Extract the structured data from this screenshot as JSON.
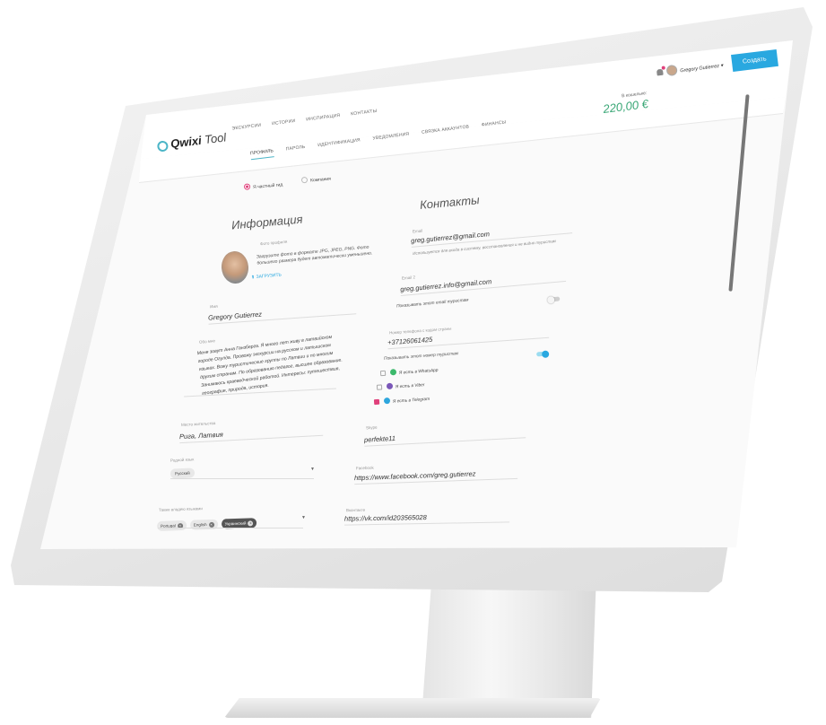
{
  "header": {
    "logo_text": "Qwixi",
    "logo_suffix": "Tool",
    "nav": [
      "ЭКСКУРСИИ",
      "ИСТОРИИ",
      "ИНСПИРАЦИЯ",
      "КОНТАКТЫ"
    ],
    "user_name": "Gregory Gutierrez",
    "create_label": "Создать",
    "wallet_label": "В кошельке:",
    "wallet_value": "220,00 €"
  },
  "tabs": [
    "ПРОФИЛЬ",
    "ПАРОЛЬ",
    "ИДЕНТИФИКАЦИЯ",
    "УВЕДОМЛЕНИЯ",
    "СВЯЗКА АККАУНТОВ",
    "ФИНАНСЫ"
  ],
  "account_type": {
    "private": "Я частный гид",
    "company": "Компания"
  },
  "info": {
    "heading": "Информация",
    "photo_label": "Фото профиля",
    "photo_desc_1": "Загрузите фото в формате JPG, JPEG, PNG. Фото",
    "photo_desc_2": "большего размера будет автоматически уменьшено.",
    "upload_label": "ЗАГРУЗИТЬ",
    "name_label": "Имя",
    "name_value": "Gregory Gutierrez",
    "about_label": "Обо мне",
    "about_text": "Меня зовут Анна Ганзберга. Я много лет живу в латвийском городе Огулда. Провожу экскурсии на русском и латышском языках. Вожу туристические группы по Латвии и по многим другим странам. По образованию педагог, высшее образование. Занимаюсь краеведческой работой. Интересы: путешествия, география, природа, история.",
    "city_label": "Место жительства",
    "city_value": "Рига, Латвия",
    "native_lang_label": "Родной язык",
    "native_lang_value": "Русский",
    "other_langs_label": "Также владею языками",
    "other_langs": [
      "Portugal",
      "English",
      "Украинский"
    ]
  },
  "contacts": {
    "heading": "Контакты",
    "email_label": "Email",
    "email_value": "greg.gutierrez@gmail.com",
    "email_hint": "Используется для входа в систему, восстановления и не видно туристам",
    "email2_label": "Email 2",
    "email2_value": "greg.gutierrez.info@gmail.com",
    "show_email_label": "Показывать этот email туристам",
    "phone_label": "Номер телефона с кодом страны",
    "phone_value": "+37126061425",
    "show_phone_label": "Показывать этот номер туристам",
    "whatsapp_label": "Я есть в WhatsApp",
    "viber_label": "Я есть в Viber",
    "telegram_label": "Я есть в Telegram",
    "skype_label": "Skype",
    "skype_value": "perfekte11",
    "facebook_label": "Facebook",
    "facebook_value": "https://www.facebook.com/greg.gutierrez",
    "vk_label": "Вконтакте",
    "vk_value": "https://vk.com/id203565028"
  },
  "state": {
    "show_email_toggle": false,
    "show_phone_toggle": true,
    "whatsapp_checked": false,
    "viber_checked": false,
    "telegram_checked": true,
    "account_type_selected": "private"
  },
  "colors": {
    "accent": "#29a8e0",
    "wallet": "#3aa776",
    "pink": "#e0407b"
  }
}
